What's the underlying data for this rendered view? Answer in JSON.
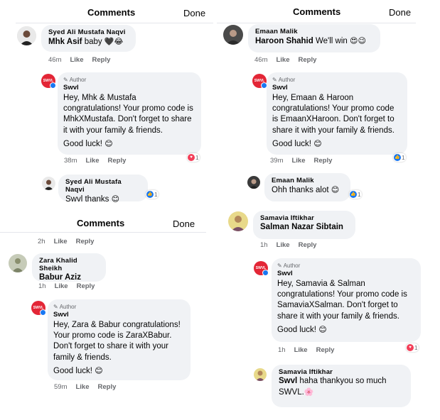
{
  "header": {
    "title": "Comments",
    "done": "Done"
  },
  "p1": {
    "c1": {
      "name": "Syed Ali Mustafa Naqvi",
      "text_bold": "Mhk Asif",
      "text": "baby",
      "emoji": "🖤😂",
      "time": "46m",
      "like": "Like",
      "reply": "Reply"
    },
    "reply": {
      "author": "Author",
      "name": "Swvl",
      "text": "Hey, Mhk & Mustafa congratulations! Your promo code is MhkXMustafa. Don't forget to share it with your family & friends.",
      "text2": "Good luck!",
      "emoji": "😊",
      "time": "38m",
      "like": "Like",
      "reply": "Reply",
      "reaction_count": "1"
    },
    "c2": {
      "name": "Syed Ali Mustafa Naqvi",
      "text": "Swvl  thanks",
      "emoji": "😊",
      "reaction_count": "1"
    }
  },
  "p2": {
    "c1": {
      "name": "Emaan Malik",
      "text_bold": "Haroon Shahid",
      "text": "We'll win",
      "emoji": "😍😉",
      "time": "46m",
      "like": "Like",
      "reply": "Reply"
    },
    "reply": {
      "author": "Author",
      "name": "Swvl",
      "text": "Hey, Emaan & Haroon congratulations! Your promo code is EmaanXHaroon. Don't forget to share it with your family & friends.",
      "text2": "Good luck!",
      "emoji": "😊",
      "time": "39m",
      "like": "Like",
      "reply": "Reply",
      "reaction_count": "1"
    },
    "c2": {
      "name": "Emaan Malik",
      "text": "Ohh thanks alot",
      "emoji": "😊",
      "reaction_count": "1"
    }
  },
  "p3": {
    "top": {
      "time": "2h",
      "like": "Like",
      "reply": "Reply"
    },
    "c1": {
      "name": "Zara Khalid Sheikh",
      "text_bold": "Babur Aziz",
      "time": "1h",
      "like": "Like",
      "reply": "Reply"
    },
    "reply": {
      "author": "Author",
      "name": "Swvl",
      "text": "Hey, Zara & Babur congratulations! Your promo code is ZaraXBabur. Don't forget to share it with your family & friends.",
      "text2": "Good luck!",
      "emoji": "😊",
      "time": "59m",
      "like": "Like",
      "reply": "Reply"
    }
  },
  "p4": {
    "c1": {
      "name": "Samavia Iftikhar",
      "text_bold": "Salman Nazar Sibtain",
      "time": "1h",
      "like": "Like",
      "reply": "Reply"
    },
    "reply": {
      "author": "Author",
      "name": "Swvl",
      "text": "Hey, Samavia & Salman congratulations! Your promo code is SamaviaXSalman. Don't forget to share it with your family & friends.",
      "text2": "Good luck!",
      "emoji": "😊",
      "time": "1h",
      "like": "Like",
      "reply": "Reply",
      "reaction_count": "1"
    },
    "c2": {
      "name": "Samavia Iftikhar",
      "text_bold": "Swvl",
      "text": "haha thankyou so much SWVL.",
      "emoji": "🌸"
    }
  },
  "colors": {
    "bubble": "#f0f2f5",
    "meta": "#65676b",
    "swvl_brand": "#e32636",
    "like_blue": "#1877f2",
    "heart_red": "#f33e58"
  },
  "icons": [
    "pencil-icon",
    "heart-reaction-icon",
    "like-reaction-icon",
    "verified-badge-icon"
  ]
}
